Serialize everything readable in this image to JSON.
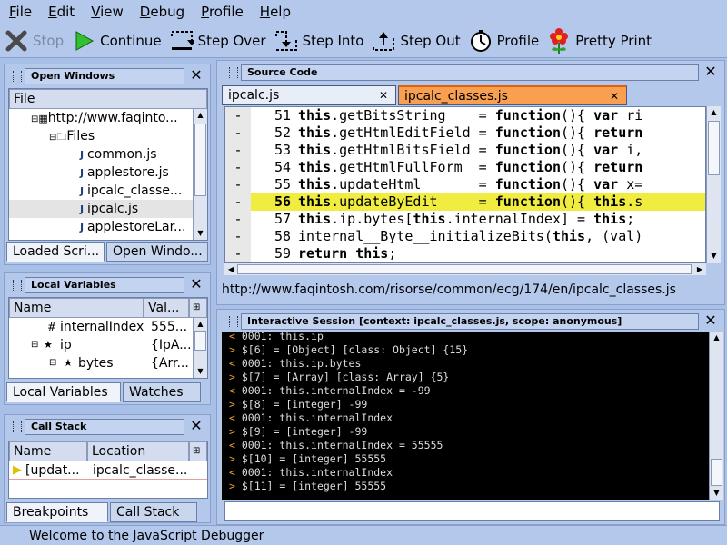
{
  "menu": {
    "items": [
      {
        "ul": "F",
        "rest": "ile"
      },
      {
        "ul": "E",
        "rest": "dit"
      },
      {
        "ul": "V",
        "rest": "iew"
      },
      {
        "ul": "D",
        "rest": "ebug"
      },
      {
        "ul": "P",
        "rest": "rofile"
      },
      {
        "ul": "H",
        "rest": "elp"
      }
    ]
  },
  "toolbar": {
    "stop": "Stop",
    "continue": "Continue",
    "step_over": "Step Over",
    "step_into": "Step Into",
    "step_out": "Step Out",
    "profile": "Profile",
    "pretty_print": "Pretty Print"
  },
  "open_windows": {
    "title": "Open Windows",
    "column": "File",
    "tree": [
      {
        "text": "http://www.faqintosh.com/risorse/common/ecg/174/en/",
        "display": "http://www.faqinto..."
      },
      {
        "text": "Files"
      },
      {
        "text": "common.js"
      },
      {
        "text": "applestore.js"
      },
      {
        "text": "ipcalc_classe..."
      },
      {
        "text": "ipcalc.js"
      },
      {
        "text": "applestoreLar..."
      }
    ],
    "tabs": [
      "Loaded Scri...",
      "Open Windo..."
    ]
  },
  "local_variables": {
    "title": "Local Variables",
    "columns": [
      "Name",
      "Val..."
    ],
    "rows": [
      {
        "name": "internalIndex",
        "value": "555..."
      },
      {
        "name": "ip",
        "value": "{IpA..."
      },
      {
        "name": "bytes",
        "value": "{Arr..."
      }
    ],
    "tabs": [
      "Local Variables",
      "Watches"
    ]
  },
  "call_stack": {
    "title": "Call Stack",
    "columns": [
      "Name",
      "Location"
    ],
    "rows": [
      {
        "name": "[updat...",
        "location": "ipcalc_classe..."
      }
    ],
    "tabs": [
      "Breakpoints",
      "Call Stack"
    ]
  },
  "source": {
    "title": "Source Code",
    "tabs": [
      "ipcalc.js",
      "ipcalc_classes.js"
    ],
    "current_line": 56,
    "lines": [
      {
        "n": "51",
        "kw": "this",
        "rest": ".getBitsString    = ",
        "kw2": "function",
        "rest2": "(){ ",
        "kw3": "var",
        "rest3": " ri"
      },
      {
        "n": "52",
        "kw": "this",
        "rest": ".getHtmlEditField = ",
        "kw2": "function",
        "rest2": "(){ ",
        "kw3": "return",
        "rest3": ""
      },
      {
        "n": "53",
        "kw": "this",
        "rest": ".getHtmlBitsField = ",
        "kw2": "function",
        "rest2": "(){ ",
        "kw3": "var",
        "rest3": " i,"
      },
      {
        "n": "54",
        "kw": "this",
        "rest": ".getHtmlFullForm  = ",
        "kw2": "function",
        "rest2": "(){ ",
        "kw3": "return",
        "rest3": ""
      },
      {
        "n": "55",
        "kw": "this",
        "rest": ".updateHtml       = ",
        "kw2": "function",
        "rest2": "(){ ",
        "kw3": "var",
        "rest3": " x="
      },
      {
        "n": "56",
        "kw": "this",
        "rest": ".updateByEdit     = ",
        "kw2": "function",
        "rest2": "(){ ",
        "kw3": "this",
        "rest3": ".s"
      },
      {
        "n": "57",
        "kw": "this",
        "rest": ".ip.bytes[",
        "kw2": "this",
        "rest2": ".internalIndex] = ",
        "kw3": "this",
        "rest3": ";"
      },
      {
        "n": "58",
        "kw": "",
        "rest": "internal__Byte__initializeBits(",
        "kw2": "this",
        "rest2": ", (val)",
        "kw3": "",
        "rest3": ""
      },
      {
        "n": "59",
        "kw": "return",
        "rest": " ",
        "kw2": "this",
        "rest2": ";",
        "kw3": "",
        "rest3": ""
      }
    ],
    "url": "http://www.faqintosh.com/risorse/common/ecg/174/en/ipcalc_classes.js"
  },
  "console": {
    "title": "Interactive Session [context: ipcalc_classes.js, scope: anonymous]",
    "lines": [
      {
        "p": "<",
        "t": " 0001: this.ip"
      },
      {
        "p": ">",
        "t": " $[6] = [Object] [class: Object] {15}"
      },
      {
        "p": "<",
        "t": " 0001: this.ip.bytes"
      },
      {
        "p": ">",
        "t": " $[7] = [Array] [class: Array] {5}"
      },
      {
        "p": "<",
        "t": " 0001: this.internalIndex = -99"
      },
      {
        "p": ">",
        "t": " $[8] = [integer] -99"
      },
      {
        "p": "<",
        "t": " 0001: this.internalIndex"
      },
      {
        "p": ">",
        "t": " $[9] = [integer] -99"
      },
      {
        "p": "<",
        "t": " 0001: this.internalIndex = 55555"
      },
      {
        "p": ">",
        "t": " $[10] = [integer] 55555"
      },
      {
        "p": "<",
        "t": " 0001: this.internalIndex"
      },
      {
        "p": ">",
        "t": " $[11] = [integer] 55555"
      }
    ]
  },
  "status": "Welcome to the JavaScript Debugger",
  "colors": {
    "accent": "#b4c8ec",
    "highlight_line": "#f0ec40",
    "active_tab": "#f8a050",
    "console_prefix": "#e8a030"
  }
}
